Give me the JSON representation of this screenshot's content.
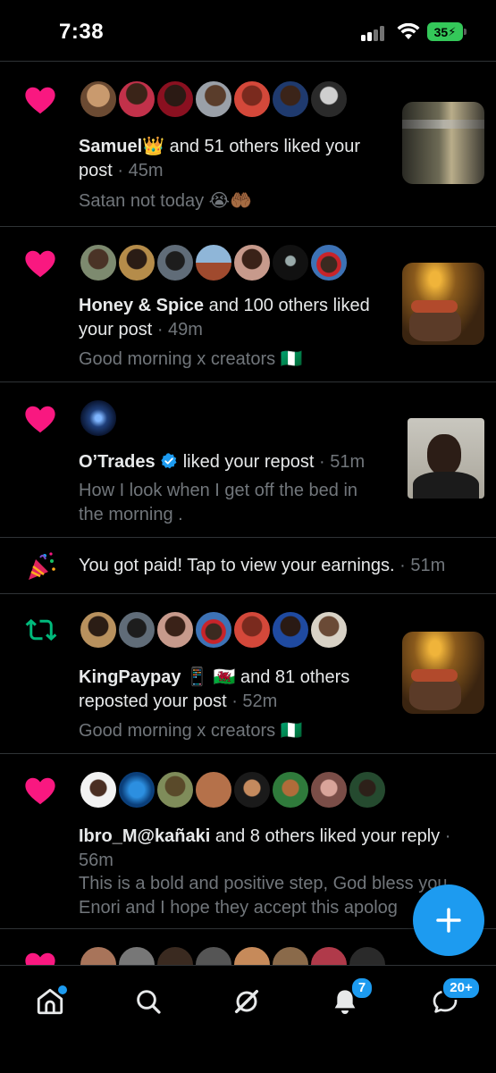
{
  "status_bar": {
    "time": "7:38",
    "battery": "35"
  },
  "notifications": [
    {
      "type": "like",
      "actor": "Samuel👑",
      "action": " and 51 others liked your post",
      "time": " · 45m",
      "snippet": "Satan not today 😭🤲🏾"
    },
    {
      "type": "like",
      "actor": "Honey & Spice",
      "action": " and 100 others liked your post",
      "time": " · 49m",
      "snippet": "Good morning x creators 🇳🇬"
    },
    {
      "type": "like",
      "actor": "O’Trades",
      "action": " liked your repost",
      "time": " · 51m",
      "snippet": "How I look when I get off the bed in the morning ."
    },
    {
      "type": "earnings",
      "text": "You got paid! Tap to view your earnings.",
      "time": " · 51m"
    },
    {
      "type": "repost",
      "actor": "KingPaypay 📱 🏴󠁧󠁢󠁷󠁬󠁳󠁿",
      "action": " and 81 others reposted your post",
      "time": " · 52m",
      "snippet": "Good morning x creators 🇳🇬"
    },
    {
      "type": "like",
      "actor": "Ibro_M@kañaki",
      "action": " and 8 others liked your reply",
      "time": " · 56m",
      "snippet": "This is a bold and positive step, God bless you Enori and I hope they accept this apolog"
    }
  ],
  "bottom_nav": {
    "items": [
      "home-icon",
      "search-icon",
      "grok-icon",
      "notifications-bell-icon",
      "messages-icon"
    ],
    "notifications_badge": "7",
    "messages_badge": "20+"
  },
  "colors": {
    "like": "#f91880",
    "repost": "#00ba7c",
    "accent": "#1d9bf0",
    "muted": "#71767b"
  }
}
